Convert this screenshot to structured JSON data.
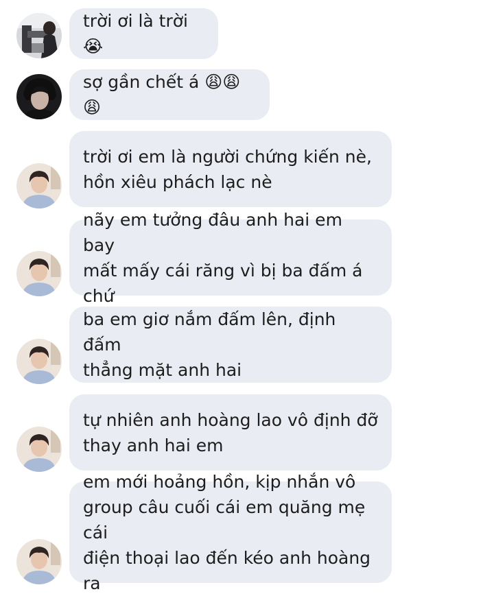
{
  "messages": [
    {
      "text": "trời ơi là trời 😭",
      "avatar": "sender-a-avatar"
    },
    {
      "text": "sợ gần chết á 😩😩😩",
      "avatar": "sender-b-avatar"
    },
    {
      "text": "trời ơi em là người chứng kiến nè,\nhồn xiêu phách lạc nè",
      "avatar": "sender-c-avatar"
    },
    {
      "text": "nãy em tưởng đâu anh hai em bay\nmất mấy cái răng vì bị ba đấm á chứ",
      "avatar": "sender-c-avatar"
    },
    {
      "text": "ba em giơ nắm đấm lên, định đấm\nthẳng mặt anh hai",
      "avatar": "sender-c-avatar"
    },
    {
      "text": "tự nhiên anh hoàng lao vô định đỡ\nthay anh hai em",
      "avatar": "sender-c-avatar"
    },
    {
      "text": "em mới hoảng hồn, kịp nhắn vô\ngroup câu cuối cái em quăng mẹ cái\nđiện thoại lao đến kéo anh hoàng ra",
      "avatar": "sender-c-avatar"
    }
  ],
  "colors": {
    "bubble": "#e9ecf2",
    "text": "#1d1d1d",
    "background": "#ffffff"
  }
}
